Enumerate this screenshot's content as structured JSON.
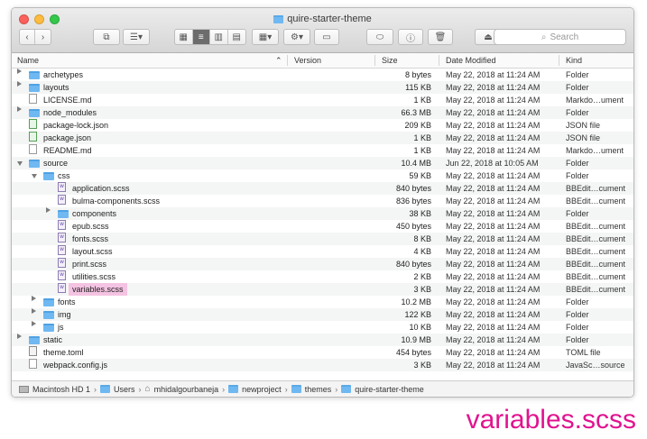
{
  "window": {
    "title": "quire-starter-theme"
  },
  "toolbar": {
    "back": "‹",
    "forward": "›",
    "search_placeholder": "Search",
    "search_icon": "magnifier-icon"
  },
  "columns": {
    "name": "Name",
    "version": "Version",
    "size": "Size",
    "date": "Date Modified",
    "kind": "Kind"
  },
  "rows": [
    {
      "name": "archetypes",
      "size": "8 bytes",
      "date": "May 22, 2018 at 11:24 AM",
      "kind": "Folder",
      "icon": "folder",
      "depth": 0,
      "disc": "closed"
    },
    {
      "name": "layouts",
      "size": "115 KB",
      "date": "May 22, 2018 at 11:24 AM",
      "kind": "Folder",
      "icon": "folder",
      "depth": 0,
      "disc": "closed"
    },
    {
      "name": "LICENSE.md",
      "size": "1 KB",
      "date": "May 22, 2018 at 11:24 AM",
      "kind": "Markdo…ument",
      "icon": "doc",
      "depth": 0,
      "disc": ""
    },
    {
      "name": "node_modules",
      "size": "66.3 MB",
      "date": "May 22, 2018 at 11:24 AM",
      "kind": "Folder",
      "icon": "folder",
      "depth": 0,
      "disc": "closed"
    },
    {
      "name": "package-lock.json",
      "size": "209 KB",
      "date": "May 22, 2018 at 11:24 AM",
      "kind": "JSON file",
      "icon": "json",
      "depth": 0,
      "disc": ""
    },
    {
      "name": "package.json",
      "size": "1 KB",
      "date": "May 22, 2018 at 11:24 AM",
      "kind": "JSON file",
      "icon": "json",
      "depth": 0,
      "disc": ""
    },
    {
      "name": "README.md",
      "size": "1 KB",
      "date": "May 22, 2018 at 11:24 AM",
      "kind": "Markdo…ument",
      "icon": "doc",
      "depth": 0,
      "disc": ""
    },
    {
      "name": "source",
      "size": "10.4 MB",
      "date": "Jun 22, 2018 at 10:05 AM",
      "kind": "Folder",
      "icon": "folder",
      "depth": 0,
      "disc": "open"
    },
    {
      "name": "css",
      "size": "59 KB",
      "date": "May 22, 2018 at 11:24 AM",
      "kind": "Folder",
      "icon": "folder",
      "depth": 1,
      "disc": "open"
    },
    {
      "name": "application.scss",
      "size": "840 bytes",
      "date": "May 22, 2018 at 11:24 AM",
      "kind": "BBEdit…cument",
      "icon": "scss",
      "depth": 2,
      "disc": ""
    },
    {
      "name": "bulma-components.scss",
      "size": "836 bytes",
      "date": "May 22, 2018 at 11:24 AM",
      "kind": "BBEdit…cument",
      "icon": "scss",
      "depth": 2,
      "disc": ""
    },
    {
      "name": "components",
      "size": "38 KB",
      "date": "May 22, 2018 at 11:24 AM",
      "kind": "Folder",
      "icon": "folder",
      "depth": 2,
      "disc": "closed"
    },
    {
      "name": "epub.scss",
      "size": "450 bytes",
      "date": "May 22, 2018 at 11:24 AM",
      "kind": "BBEdit…cument",
      "icon": "scss",
      "depth": 2,
      "disc": ""
    },
    {
      "name": "fonts.scss",
      "size": "8 KB",
      "date": "May 22, 2018 at 11:24 AM",
      "kind": "BBEdit…cument",
      "icon": "scss",
      "depth": 2,
      "disc": ""
    },
    {
      "name": "layout.scss",
      "size": "4 KB",
      "date": "May 22, 2018 at 11:24 AM",
      "kind": "BBEdit…cument",
      "icon": "scss",
      "depth": 2,
      "disc": ""
    },
    {
      "name": "print.scss",
      "size": "840 bytes",
      "date": "May 22, 2018 at 11:24 AM",
      "kind": "BBEdit…cument",
      "icon": "scss",
      "depth": 2,
      "disc": ""
    },
    {
      "name": "utilities.scss",
      "size": "2 KB",
      "date": "May 22, 2018 at 11:24 AM",
      "kind": "BBEdit…cument",
      "icon": "scss",
      "depth": 2,
      "disc": ""
    },
    {
      "name": "variables.scss",
      "size": "3 KB",
      "date": "May 22, 2018 at 11:24 AM",
      "kind": "BBEdit…cument",
      "icon": "scss",
      "depth": 2,
      "disc": "",
      "highlight": true
    },
    {
      "name": "fonts",
      "size": "10.2 MB",
      "date": "May 22, 2018 at 11:24 AM",
      "kind": "Folder",
      "icon": "folder",
      "depth": 1,
      "disc": "closed"
    },
    {
      "name": "img",
      "size": "122 KB",
      "date": "May 22, 2018 at 11:24 AM",
      "kind": "Folder",
      "icon": "folder",
      "depth": 1,
      "disc": "closed"
    },
    {
      "name": "js",
      "size": "10 KB",
      "date": "May 22, 2018 at 11:24 AM",
      "kind": "Folder",
      "icon": "folder",
      "depth": 1,
      "disc": "closed"
    },
    {
      "name": "static",
      "size": "10.9 MB",
      "date": "May 22, 2018 at 11:24 AM",
      "kind": "Folder",
      "icon": "folder",
      "depth": 0,
      "disc": "closed"
    },
    {
      "name": "theme.toml",
      "size": "454 bytes",
      "date": "May 22, 2018 at 11:24 AM",
      "kind": "TOML file",
      "icon": "toml",
      "depth": 0,
      "disc": ""
    },
    {
      "name": "webpack.config.js",
      "size": "3 KB",
      "date": "May 22, 2018 at 11:24 AM",
      "kind": "JavaSc…source",
      "icon": "doc",
      "depth": 0,
      "disc": ""
    }
  ],
  "pathbar": [
    "Macintosh HD 1",
    "Users",
    "mhidalgourbaneja",
    "newproject",
    "themes",
    "quire-starter-theme"
  ],
  "caption": "variables.scss",
  "colors": {
    "highlight": "#f4c3e2",
    "caption": "#e0148f",
    "folder": "#6fb8f1"
  }
}
